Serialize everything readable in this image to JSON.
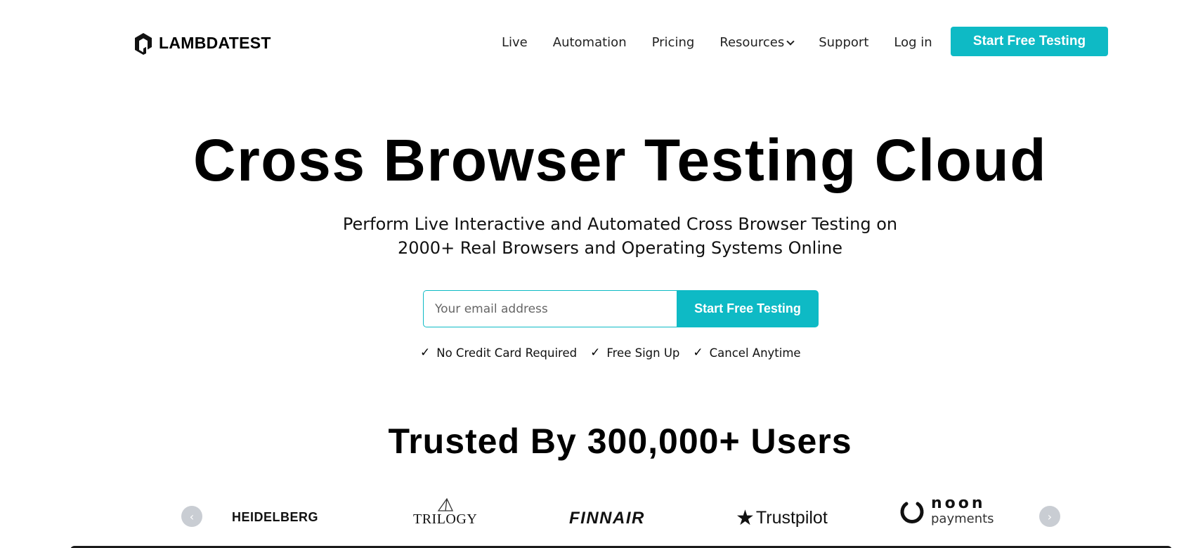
{
  "header": {
    "logo_text": "LAMBDATEST",
    "nav": [
      {
        "label": "Live"
      },
      {
        "label": "Automation"
      },
      {
        "label": "Pricing"
      },
      {
        "label": "Resources",
        "has_dropdown": true
      },
      {
        "label": "Support"
      },
      {
        "label": "Log in"
      }
    ],
    "cta_label": "Start Free Testing"
  },
  "hero": {
    "title": "Cross Browser Testing Cloud",
    "subtitle_line1": "Perform Live Interactive and Automated Cross Browser Testing on",
    "subtitle_line2": "2000+ Real Browsers and Operating Systems Online",
    "email_placeholder": "Your email address",
    "signup_label": "Start Free Testing",
    "checks": [
      "No Credit Card Required",
      "Free Sign Up",
      "Cancel Anytime"
    ]
  },
  "trusted": {
    "heading": "Trusted By 300,000+ Users",
    "brands": {
      "heidelberg": "HEIDELBERG",
      "trilogy": "TRILOGY",
      "finnair": "FINNAIR",
      "trustpilot": "Trustpilot",
      "noon_line1": "noon",
      "noon_line2": "payments"
    },
    "arrow_prev": "‹",
    "arrow_next": "›"
  },
  "colors": {
    "accent": "#0ebac5",
    "text": "#000000",
    "arrow_bg": "#c9cdd3"
  },
  "icons": {
    "logo": "lambdatest-logo-icon",
    "dropdown": "chevron-down-icon",
    "check": "check-icon",
    "trustpilot_star": "star-icon"
  }
}
